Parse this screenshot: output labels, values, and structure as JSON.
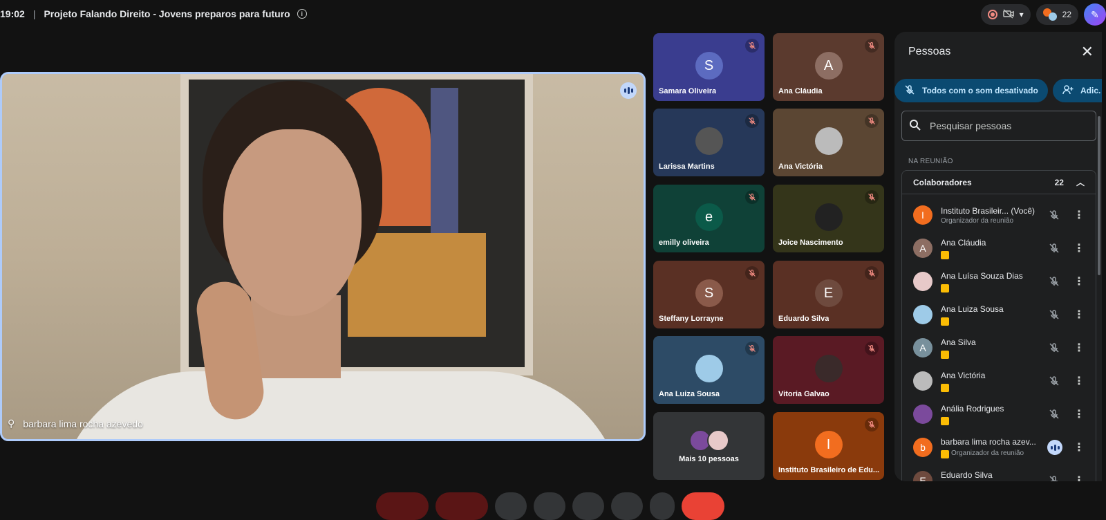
{
  "header": {
    "time": "19:02",
    "separator": "|",
    "meeting_title": "Projeto Falando Direito - Jovens preparos para futuro",
    "info_icon": "info-icon",
    "participant_count": "22"
  },
  "main_speaker": {
    "name": "barbara lima rocha azevedo"
  },
  "tiles": [
    {
      "name": "Samara Oliveira",
      "initial": "S",
      "bg": "#3a3d8f",
      "avatar_bg": "#5c6bc0"
    },
    {
      "name": "Ana Cláudia",
      "initial": "A",
      "bg": "#5b3a2e",
      "avatar_bg": "#8d6e63"
    },
    {
      "name": "Larissa Martins",
      "initial": "",
      "bg": "#263859",
      "avatar_bg": "#555"
    },
    {
      "name": "Ana Victória",
      "initial": "",
      "bg": "#5b4633",
      "avatar_bg": "#bbb"
    },
    {
      "name": "emilly oliveira",
      "initial": "e",
      "bg": "#0f4137",
      "avatar_bg": "#0b5a49"
    },
    {
      "name": "Joice Nascimento",
      "initial": "",
      "bg": "#34351a",
      "avatar_bg": "#222"
    },
    {
      "name": "Steffany Lorrayne",
      "initial": "S",
      "bg": "#5a3024",
      "avatar_bg": "#8a5a4a"
    },
    {
      "name": "Eduardo Silva",
      "initial": "E",
      "bg": "#5a3024",
      "avatar_bg": "#6e4a3e"
    },
    {
      "name": "Ana Luiza Sousa",
      "initial": "",
      "bg": "#2d4b66",
      "avatar_bg": "#9ecbe8"
    },
    {
      "name": "Vitoria Galvao",
      "initial": "",
      "bg": "#5a1a24",
      "avatar_bg": "#3a2a2a"
    },
    {
      "name": "Mais 10 pessoas",
      "initial": "",
      "bg": "#333537",
      "avatar_bg": "#666"
    },
    {
      "name": "Instituto Brasileiro de Edu...",
      "initial": "I",
      "bg": "#8a3a0c",
      "avatar_bg": "#f26d1f"
    }
  ],
  "people_panel": {
    "title": "Pessoas",
    "mute_all_label": "Todos com o som desativado",
    "add_label": "Adic. p",
    "search_placeholder": "Pesquisar pessoas",
    "section_label": "NA REUNIÃO",
    "group_name": "Colaboradores",
    "group_count": "22",
    "participants": [
      {
        "name": "Instituto Brasileir...  (Você)",
        "sub": "Organizador da reunião",
        "initial": "I",
        "avatar_bg": "#f26d1f"
      },
      {
        "name": "Ana Cláudia",
        "sub": "",
        "initial": "A",
        "avatar_bg": "#8d6e63"
      },
      {
        "name": "Ana Luísa Souza Dias",
        "sub": "",
        "initial": "",
        "avatar_bg": "#e7c9c9"
      },
      {
        "name": "Ana Luiza Sousa",
        "sub": "",
        "initial": "",
        "avatar_bg": "#9ecbe8"
      },
      {
        "name": "Ana Silva",
        "sub": "",
        "initial": "A",
        "avatar_bg": "#78909c"
      },
      {
        "name": "Ana Victória",
        "sub": "",
        "initial": "",
        "avatar_bg": "#bbb"
      },
      {
        "name": "Anália Rodrigues",
        "sub": "",
        "initial": "",
        "avatar_bg": "#7b4a9c"
      },
      {
        "name": "barbara lima rocha azev...",
        "sub": "Organizador da reunião",
        "initial": "b",
        "avatar_bg": "#f26d1f"
      },
      {
        "name": "Eduardo Silva",
        "sub": "",
        "initial": "E",
        "avatar_bg": "#6e4a3e"
      }
    ]
  },
  "colors": {
    "accent": "#aecbfa",
    "chip_bg": "#0b4a71",
    "collaborator_badge": "#fbbc04",
    "end_call": "#e94235"
  }
}
